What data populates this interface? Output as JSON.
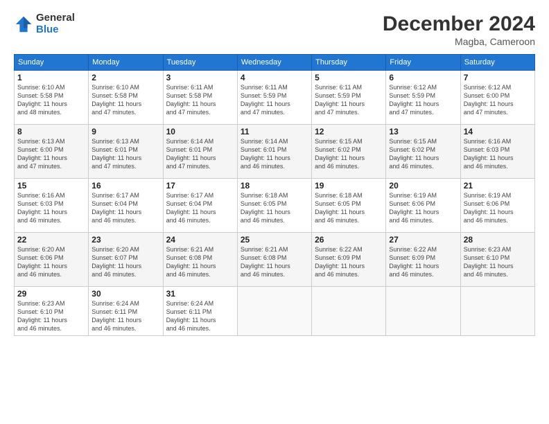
{
  "logo": {
    "general": "General",
    "blue": "Blue"
  },
  "title": "December 2024",
  "location": "Magba, Cameroon",
  "headers": [
    "Sunday",
    "Monday",
    "Tuesday",
    "Wednesday",
    "Thursday",
    "Friday",
    "Saturday"
  ],
  "weeks": [
    [
      {
        "day": "1",
        "detail": "Sunrise: 6:10 AM\nSunset: 5:58 PM\nDaylight: 11 hours\nand 48 minutes."
      },
      {
        "day": "2",
        "detail": "Sunrise: 6:10 AM\nSunset: 5:58 PM\nDaylight: 11 hours\nand 47 minutes."
      },
      {
        "day": "3",
        "detail": "Sunrise: 6:11 AM\nSunset: 5:58 PM\nDaylight: 11 hours\nand 47 minutes."
      },
      {
        "day": "4",
        "detail": "Sunrise: 6:11 AM\nSunset: 5:59 PM\nDaylight: 11 hours\nand 47 minutes."
      },
      {
        "day": "5",
        "detail": "Sunrise: 6:11 AM\nSunset: 5:59 PM\nDaylight: 11 hours\nand 47 minutes."
      },
      {
        "day": "6",
        "detail": "Sunrise: 6:12 AM\nSunset: 5:59 PM\nDaylight: 11 hours\nand 47 minutes."
      },
      {
        "day": "7",
        "detail": "Sunrise: 6:12 AM\nSunset: 6:00 PM\nDaylight: 11 hours\nand 47 minutes."
      }
    ],
    [
      {
        "day": "8",
        "detail": "Sunrise: 6:13 AM\nSunset: 6:00 PM\nDaylight: 11 hours\nand 47 minutes."
      },
      {
        "day": "9",
        "detail": "Sunrise: 6:13 AM\nSunset: 6:01 PM\nDaylight: 11 hours\nand 47 minutes."
      },
      {
        "day": "10",
        "detail": "Sunrise: 6:14 AM\nSunset: 6:01 PM\nDaylight: 11 hours\nand 47 minutes."
      },
      {
        "day": "11",
        "detail": "Sunrise: 6:14 AM\nSunset: 6:01 PM\nDaylight: 11 hours\nand 46 minutes."
      },
      {
        "day": "12",
        "detail": "Sunrise: 6:15 AM\nSunset: 6:02 PM\nDaylight: 11 hours\nand 46 minutes."
      },
      {
        "day": "13",
        "detail": "Sunrise: 6:15 AM\nSunset: 6:02 PM\nDaylight: 11 hours\nand 46 minutes."
      },
      {
        "day": "14",
        "detail": "Sunrise: 6:16 AM\nSunset: 6:03 PM\nDaylight: 11 hours\nand 46 minutes."
      }
    ],
    [
      {
        "day": "15",
        "detail": "Sunrise: 6:16 AM\nSunset: 6:03 PM\nDaylight: 11 hours\nand 46 minutes."
      },
      {
        "day": "16",
        "detail": "Sunrise: 6:17 AM\nSunset: 6:04 PM\nDaylight: 11 hours\nand 46 minutes."
      },
      {
        "day": "17",
        "detail": "Sunrise: 6:17 AM\nSunset: 6:04 PM\nDaylight: 11 hours\nand 46 minutes."
      },
      {
        "day": "18",
        "detail": "Sunrise: 6:18 AM\nSunset: 6:05 PM\nDaylight: 11 hours\nand 46 minutes."
      },
      {
        "day": "19",
        "detail": "Sunrise: 6:18 AM\nSunset: 6:05 PM\nDaylight: 11 hours\nand 46 minutes."
      },
      {
        "day": "20",
        "detail": "Sunrise: 6:19 AM\nSunset: 6:06 PM\nDaylight: 11 hours\nand 46 minutes."
      },
      {
        "day": "21",
        "detail": "Sunrise: 6:19 AM\nSunset: 6:06 PM\nDaylight: 11 hours\nand 46 minutes."
      }
    ],
    [
      {
        "day": "22",
        "detail": "Sunrise: 6:20 AM\nSunset: 6:06 PM\nDaylight: 11 hours\nand 46 minutes."
      },
      {
        "day": "23",
        "detail": "Sunrise: 6:20 AM\nSunset: 6:07 PM\nDaylight: 11 hours\nand 46 minutes."
      },
      {
        "day": "24",
        "detail": "Sunrise: 6:21 AM\nSunset: 6:08 PM\nDaylight: 11 hours\nand 46 minutes."
      },
      {
        "day": "25",
        "detail": "Sunrise: 6:21 AM\nSunset: 6:08 PM\nDaylight: 11 hours\nand 46 minutes."
      },
      {
        "day": "26",
        "detail": "Sunrise: 6:22 AM\nSunset: 6:09 PM\nDaylight: 11 hours\nand 46 minutes."
      },
      {
        "day": "27",
        "detail": "Sunrise: 6:22 AM\nSunset: 6:09 PM\nDaylight: 11 hours\nand 46 minutes."
      },
      {
        "day": "28",
        "detail": "Sunrise: 6:23 AM\nSunset: 6:10 PM\nDaylight: 11 hours\nand 46 minutes."
      }
    ],
    [
      {
        "day": "29",
        "detail": "Sunrise: 6:23 AM\nSunset: 6:10 PM\nDaylight: 11 hours\nand 46 minutes."
      },
      {
        "day": "30",
        "detail": "Sunrise: 6:24 AM\nSunset: 6:11 PM\nDaylight: 11 hours\nand 46 minutes."
      },
      {
        "day": "31",
        "detail": "Sunrise: 6:24 AM\nSunset: 6:11 PM\nDaylight: 11 hours\nand 46 minutes."
      },
      {
        "day": "",
        "detail": ""
      },
      {
        "day": "",
        "detail": ""
      },
      {
        "day": "",
        "detail": ""
      },
      {
        "day": "",
        "detail": ""
      }
    ]
  ]
}
